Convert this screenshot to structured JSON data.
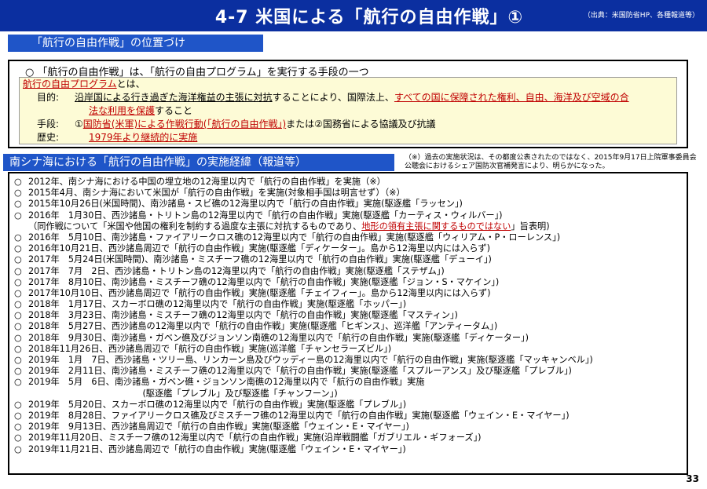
{
  "header": {
    "title": "4-7 米国による「航行の自由作戦」①",
    "source": "（出典：米国防省HP、各種報道等）",
    "color": "#0b2fa0"
  },
  "section1": {
    "band_label": "「航行の自由作戦」の位置づけ",
    "headline": "○ 「航行の自由作戦」は、「航行の自由プログラム」を実行する手段の一つ",
    "program_title_red": "航行の自由プログラム",
    "program_title_rest": "とは、",
    "purpose_label": "目的:",
    "purpose_a": "沿岸国による行き過ぎた海洋権益の主張に対抗",
    "purpose_b": "することにより、国際法上、",
    "purpose_c": "すべての国に保障された権利、自由、海洋及び空域の合",
    "purpose_d": "法な利用を保護",
    "purpose_e": "すること",
    "means_label": "手段:",
    "means_a": "①",
    "means_b": "国防省(米軍)による作戦行動(「航行の自由作戦」)",
    "means_c": "または②国務省による協議及び抗議",
    "history_label": "歴史:",
    "history_value": "1979年より継続的に実施"
  },
  "section2": {
    "band_label": "南シナ海における「航行の自由作戦」の実施経緯（報道等）",
    "note": "（※）過去の実施状況は、その都度公表されたのではなく、2015年9月17日上院軍事委員会公聴会におけるシェア国防次官補発言により、明らかになった。",
    "entries": [
      {
        "mark": "○",
        "text": "2012年、南シナ海における中国の埋立地の12海里以内で「航行の自由作戦」を実施（※）"
      },
      {
        "mark": "○",
        "text": "2015年4月、南シナ海において米国が「航行の自由作戦」を実施(対象相手国は明言せず）（※）"
      },
      {
        "mark": "○",
        "text": "2015年10月26日(米国時間)、南沙諸島・スビ礁の12海里以内で「航行の自由作戦」実施(駆逐艦「ラッセン」)"
      },
      {
        "mark": "○",
        "text": "2016年　1月30日、西沙諸島・トリトン島の12海里以内で「航行の自由作戦」実施(駆逐艦「カーティス・ウィルバー」)"
      },
      {
        "mark": "",
        "text": "（同作戦について「米国や他国の権利を制約する過度な主張に対抗するものであり、",
        "red": "地形の領有主張に関するものではない",
        "tail": "」旨表明)"
      },
      {
        "mark": "○",
        "text": "2016年　5月10日、南沙諸島・ファイアリークロス礁の12海里以内で「航行の自由作戦」実施(駆逐艦「ウィリアム・P・ローレンス」)"
      },
      {
        "mark": "○",
        "text": "2016年10月21日、西沙諸島周辺で「航行の自由作戦」実施(駆逐艦「ディケーター」。島から12海里以内には入らず)"
      },
      {
        "mark": "○",
        "text": "2017年　5月24日(米国時間)、南沙諸島・ミスチーフ礁の12海里以内で「航行の自由作戦」実施(駆逐艦「デューイ」)"
      },
      {
        "mark": "○",
        "text": "2017年　7月　2日、西沙諸島・トリトン島の12海里以内で「航行の自由作戦」実施(駆逐艦「ステザム」)"
      },
      {
        "mark": "○",
        "text": "2017年　8月10日、南沙諸島・ミスチーフ礁の12海里以内で「航行の自由作戦」実施(駆逐艦「ジョン・S・マケイン」)"
      },
      {
        "mark": "○",
        "text": "2017年10月10日、西沙諸島周辺で「航行の自由作戦」実施(駆逐艦「チェイフィー」。島から12海里以内には入らず)"
      },
      {
        "mark": "○",
        "text": "2018年　1月17日、スカーボロ礁の12海里以内で「航行の自由作戦」実施(駆逐艦「ホッパー」)"
      },
      {
        "mark": "○",
        "text": "2018年　3月23日、南沙諸島・ミスチーフ礁の12海里以内で「航行の自由作戦」実施(駆逐艦「マスティン」)"
      },
      {
        "mark": "○",
        "text": "2018年　5月27日、西沙諸島の12海里以内で「航行の自由作戦」実施(駆逐艦「ヒギンス」、巡洋艦「アンティータム」)"
      },
      {
        "mark": "○",
        "text": "2018年　9月30日、南沙諸島・ガベン礁及びジョンソン南礁の12海里以内で「航行の自由作戦」実施(駆逐艦「ディケーター」)"
      },
      {
        "mark": "○",
        "text": "2018年11月26日、西沙諸島周辺で「航行の自由作戦」実施(巡洋艦「チャンセラーズビル」)"
      },
      {
        "mark": "○",
        "text": "2019年　1月　7日、西沙諸島・ツリー島、リンカーン島及びウッディー島の12海里以内で「航行の自由作戦」実施(駆逐艦「マッキャンベル」)"
      },
      {
        "mark": "○",
        "text": "2019年　2月11日、南沙諸島・ミスチーフ礁の12海里以内で「航行の自由作戦」実施(駆逐艦「スプルーアンス」及び駆逐艦「プレブル」)"
      },
      {
        "mark": "○",
        "text": "2019年　5月　6日、南沙諸島・ガベン礁・ジョンソン南礁の12海里以内で「航行の自由作戦」実施"
      },
      {
        "mark": "",
        "text": "　　　　　　　　　　　　　(駆逐艦「プレブル」及び駆逐艦「チャンフーン」)"
      },
      {
        "mark": "○",
        "text": "2019年　5月20日、スカーボロ礁の12海里以内で「航行の自由作戦」実施(駆逐艦「プレブル」)"
      },
      {
        "mark": "○",
        "text": "2019年　8月28日、ファイアリークロス礁及びミスチーフ礁の12海里以内で「航行の自由作戦」実施(駆逐艦「ウェイン・E・マイヤー」)"
      },
      {
        "mark": "○",
        "text": "2019年　9月13日、西沙諸島周辺で「航行の自由作戦」実施(駆逐艦「ウェイン・E・マイヤー」)"
      },
      {
        "mark": "○",
        "text": "2019年11月20日、ミスチーフ礁の12海里以内で「航行の自由作戦」実施(沿岸戦闘艦「ガブリエル・ギフォーズ」)"
      },
      {
        "mark": "○",
        "text": "2019年11月21日、西沙諸島周辺で「航行の自由作戦」実施(駆逐艦「ウェイン・E・マイヤー」)"
      }
    ]
  },
  "page_number": "33"
}
